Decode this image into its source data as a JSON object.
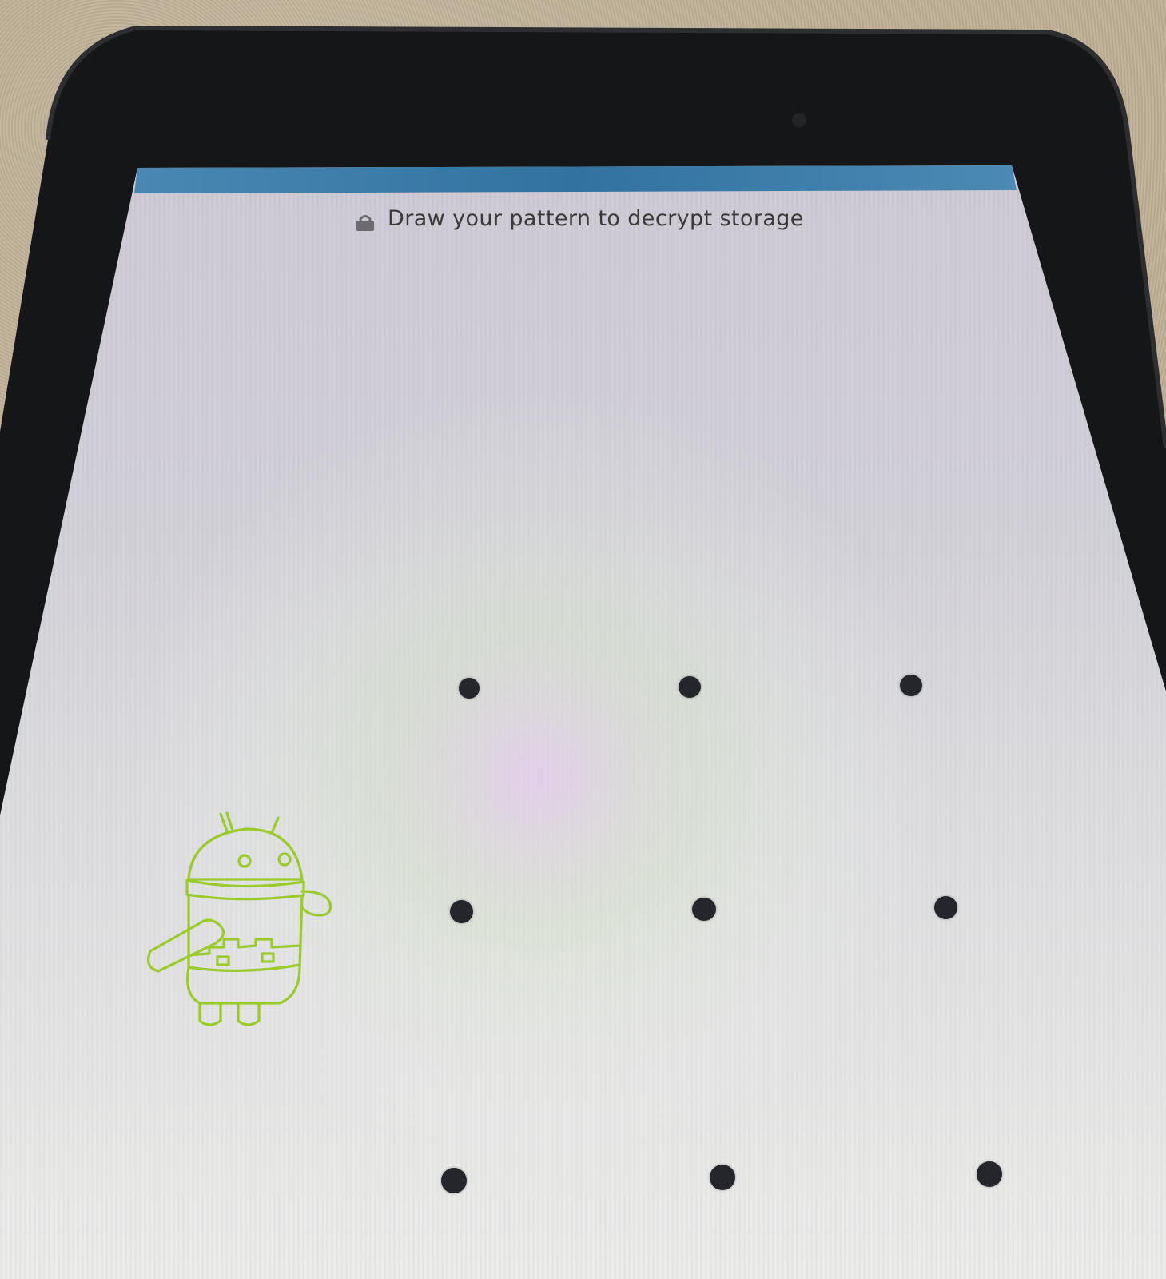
{
  "status_bar": {
    "color": "#3d7eaa"
  },
  "header": {
    "title": "Draw your pattern to decrypt storage",
    "icon": "lock-icon"
  },
  "pattern_lock": {
    "rows": 3,
    "cols": 3,
    "dot_color": "#25262c",
    "nodes": [
      "1",
      "2",
      "3",
      "4",
      "5",
      "6",
      "7",
      "8",
      "9"
    ]
  },
  "mascot": {
    "name": "android-robot",
    "color": "#9acb2a"
  }
}
